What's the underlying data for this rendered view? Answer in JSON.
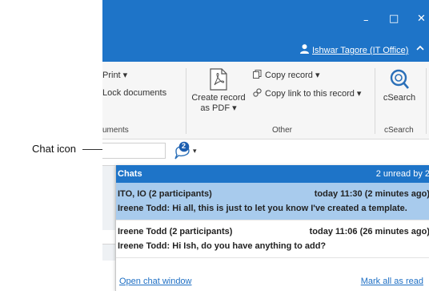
{
  "callout": {
    "label": "Chat icon"
  },
  "window": {
    "minimize_glyph": "–",
    "maximize_glyph": "□",
    "close_glyph": "✕",
    "user_name": "Ishwar Tagore (IT Office)"
  },
  "ribbon": {
    "print_label": "Print ▾",
    "lock_label": "Lock documents",
    "group_documents_label": "uments",
    "create_pdf_line1": "Create record",
    "create_pdf_line2": "as PDF ▾",
    "copy_record_label": "Copy record ▾",
    "copy_link_label": "Copy link to this record ▾",
    "group_other_label": "Other",
    "csearch_label": "cSearch",
    "group_csearch_label": "cSearch"
  },
  "chat_button": {
    "badge": "2",
    "dropdown_glyph": "▾"
  },
  "chats": {
    "title": "Chats",
    "unread": "2 unread by 2",
    "items": [
      {
        "participants": "ITO, IO (2 participants)",
        "time": "today 11:30 (2 minutes ago)",
        "message": "Ireene Todd: Hi all, this is just to let you know I've created a template."
      },
      {
        "participants": "Ireene Todd (2 participants)",
        "time": "today 11:06 (26 minutes ago)",
        "message": "Ireene Todd: Hi Ish, do you have anything to add?"
      }
    ],
    "open_window_label": "Open chat window",
    "mark_all_label": "Mark all as read"
  },
  "colors": {
    "titlebar": "#1e74c8",
    "selected_row": "#a8cbed",
    "link": "#1e6fc4"
  }
}
